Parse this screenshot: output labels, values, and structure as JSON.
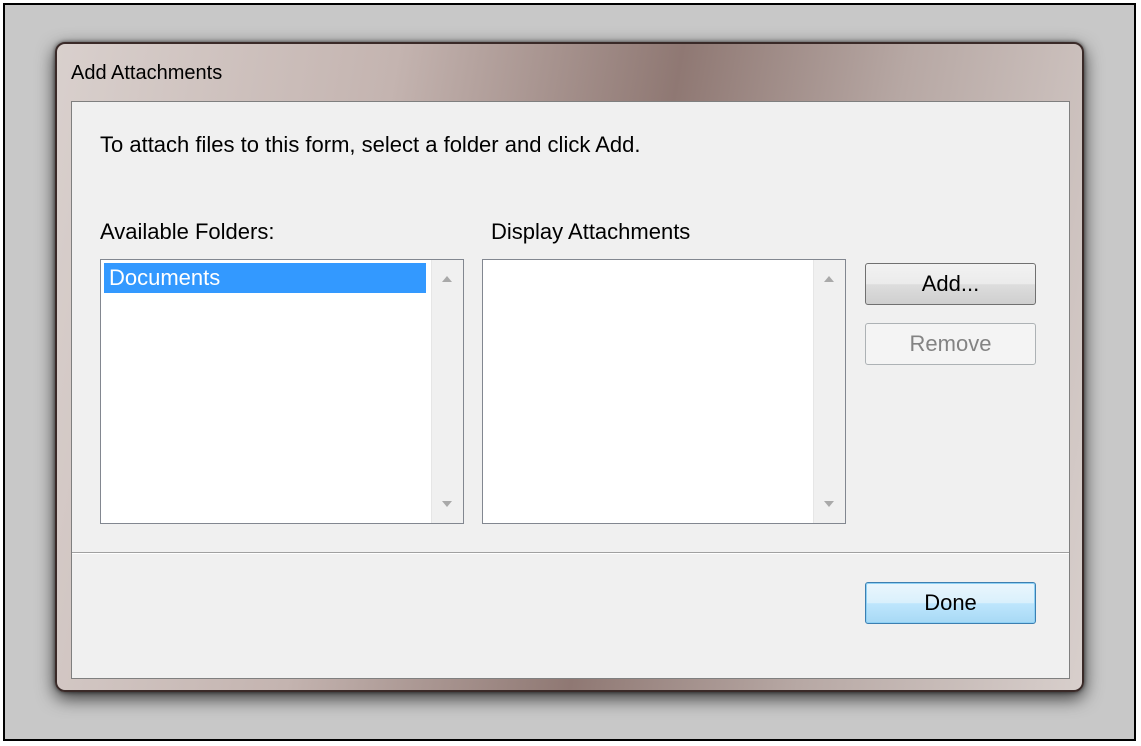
{
  "window": {
    "title": "Add Attachments"
  },
  "content": {
    "instructions": "To attach files to this form, select a folder and click Add.",
    "available_folders_label": "Available Folders:",
    "display_attachments_label": "Display Attachments"
  },
  "folders": {
    "items": [
      "Documents"
    ],
    "selected": "Documents"
  },
  "attachments": {
    "items": []
  },
  "buttons": {
    "add": "Add...",
    "remove": "Remove",
    "done": "Done"
  },
  "colors": {
    "selection": "#3399ff",
    "client_bg": "#f0f0f0",
    "default_button_border": "#3c7fb1",
    "disabled_text": "#838383"
  }
}
